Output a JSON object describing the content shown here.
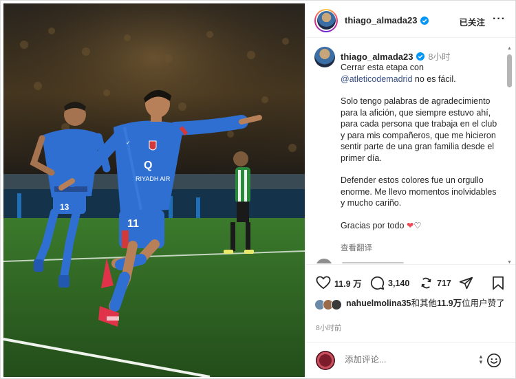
{
  "header": {
    "username": "thiago_almada23",
    "follow_state": "已关注",
    "more_glyph": "···"
  },
  "caption": {
    "username": "thiago_almada23",
    "time": "8小时",
    "line1_text": "Cerrar esta etapa con",
    "line1_mention": "@atleticodemadrid",
    "line1_end": " no es fácil.",
    "paragraph2": "Solo tengo palabras de agradecimiento para la afición, que siempre estuvo ahí, para cada persona que trabaja en el club y para mis compañeros, que me hicieron sentir parte de una gran familia desde el primer día.",
    "paragraph3": "Defender estos colores fue un orgullo enorme. Me llevo momentos inolvidables y mucho cariño.",
    "paragraph4": "Gracias por todo",
    "paragraph4_emoji_red": "❤",
    "paragraph4_emoji_white": "♡",
    "see_translation": "查看翻译"
  },
  "actions": {
    "like_count": "11.9 万",
    "comment_count": "3,140",
    "repost_count": "717",
    "icons": [
      "heart-icon",
      "comment-icon",
      "repost-icon",
      "share-icon",
      "bookmark-icon"
    ]
  },
  "likes": {
    "liker_user": "nahuelmolina35",
    "summary_prefix": "和其他",
    "summary_count": "11.9万",
    "summary_suffix": "位用户赞了"
  },
  "post_time": "8小时前",
  "comment_input": {
    "placeholder": "添加评论..."
  },
  "colors": {
    "accent_blue": "#0095f6",
    "mention": "#385185",
    "heart": "#ed4956",
    "jersey_blue": "#2f6fd1",
    "pitch_green": "#2f6b25"
  }
}
